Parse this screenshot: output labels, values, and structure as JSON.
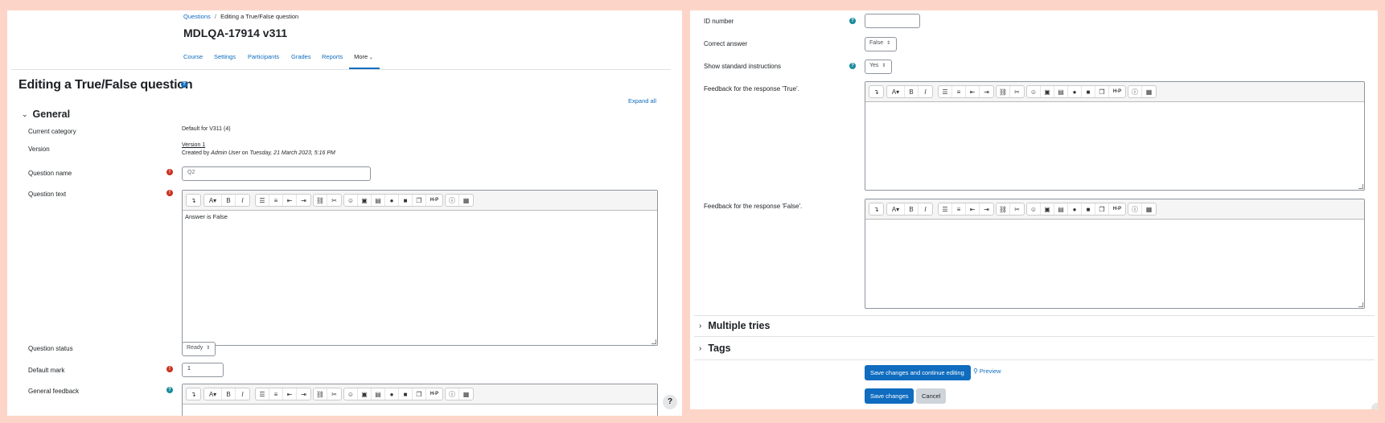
{
  "left": {
    "breadcrumb": {
      "link": "Questions",
      "sep": "/",
      "current": "Editing a True/False question"
    },
    "page_title": "MDLQA-17914 v311",
    "nav": [
      "Course",
      "Settings",
      "Participants",
      "Grades",
      "Reports",
      "More"
    ],
    "heading": "Editing a True/False question",
    "expand_all": "Expand all",
    "general_label": "General",
    "fields": {
      "current_category_label": "Current category",
      "current_category_value": "Default for V311 (4)",
      "version_label": "Version",
      "version_link": "Version 1",
      "created_prefix": "Created by",
      "created_user": "Admin User",
      "created_on": "on",
      "created_date": "Tuesday, 21 March 2023, 5:16 PM",
      "question_name_label": "Question name",
      "question_name_value": "Q2",
      "question_text_label": "Question text",
      "question_text_value": "Answer is False",
      "question_status_label": "Question status",
      "question_status_value": "Ready",
      "default_mark_label": "Default mark",
      "default_mark_value": "1",
      "general_feedback_label": "General feedback"
    },
    "help_fab": "?"
  },
  "right": {
    "id_number_label": "ID number",
    "correct_answer_label": "Correct answer",
    "correct_answer_value": "False",
    "show_instructions_label": "Show standard instructions",
    "show_instructions_value": "Yes",
    "feedback_true_label": "Feedback for the response 'True'.",
    "feedback_false_label": "Feedback for the response 'False'.",
    "multiple_tries": "Multiple tries",
    "tags": "Tags",
    "save_continue": "Save changes and continue editing",
    "preview": "Preview",
    "save": "Save changes",
    "cancel": "Cancel"
  },
  "icons": {
    "required": "!",
    "help": "?"
  },
  "colors": {
    "accent": "#0f6cbf",
    "required": "#ca3120",
    "help": "#198a9c",
    "backdrop": "#fdd5c8"
  }
}
